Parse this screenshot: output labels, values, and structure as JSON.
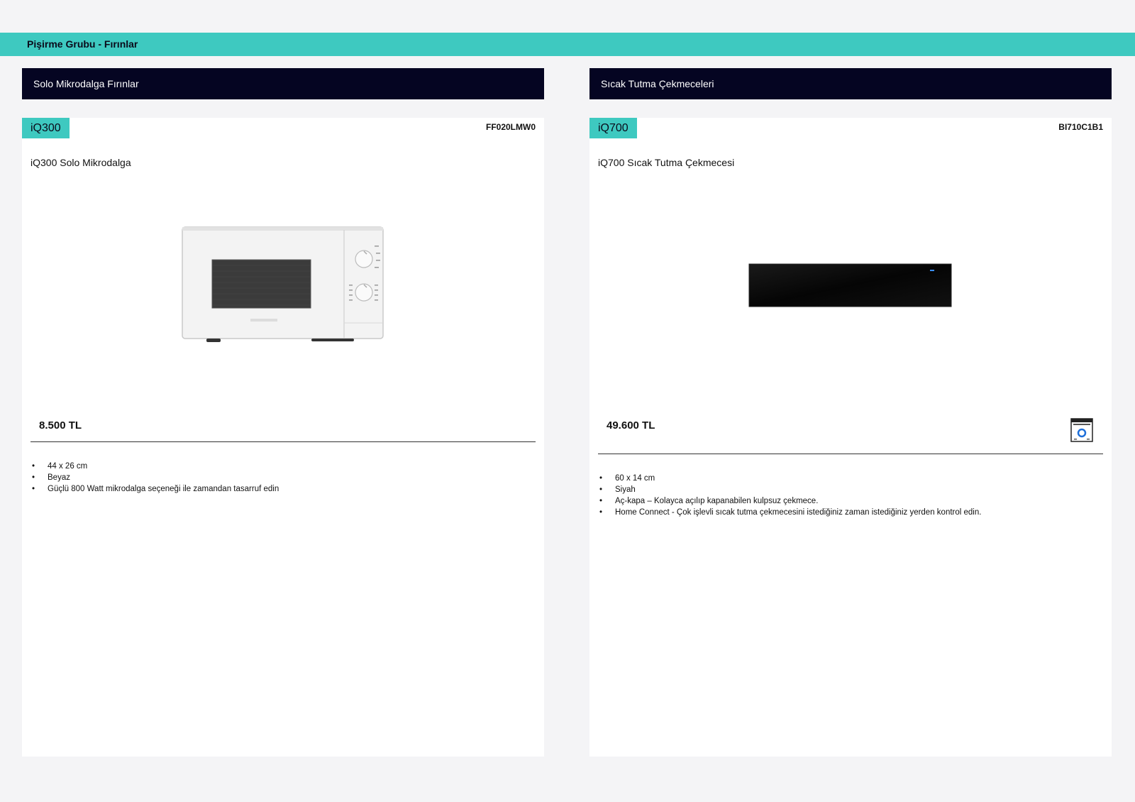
{
  "page": {
    "band_title": "Pişirme Grubu - Fırınlar"
  },
  "sections": [
    {
      "header": "Solo Mikrodalga Fırınlar",
      "product": {
        "series": "iQ300",
        "sku": "FF020LMW0",
        "title": "iQ300 Solo Mikrodalga",
        "image": "white-microwave-image",
        "price": "8.500 TL",
        "features": [
          "44 x 26 cm",
          "Beyaz",
          "Güçlü 800 Watt mikrodalga seçeneği ile zamandan tasarruf edin"
        ]
      }
    },
    {
      "header": "Sıcak Tutma Çekmeceleri",
      "product": {
        "series": "iQ700",
        "sku": "BI710C1B1",
        "title": "iQ700 Sıcak Tutma Çekmecesi",
        "image": "black-warming-drawer-image",
        "price": "49.600 TL",
        "badge_icon": "home-connect-icon",
        "features": [
          "60 x 14 cm",
          "Siyah",
          "Aç-kapa – Kolayca açılıp kapanabilen kulpsuz çekmece.",
          "Home Connect - Çok işlevli sıcak tutma çekmecesini istediğiniz zaman istediğiniz yerden kontrol edin."
        ]
      }
    }
  ],
  "colors": {
    "accent_teal": "#3ec9c0",
    "header_navy": "#050522",
    "page_bg": "#f4f4f6"
  }
}
